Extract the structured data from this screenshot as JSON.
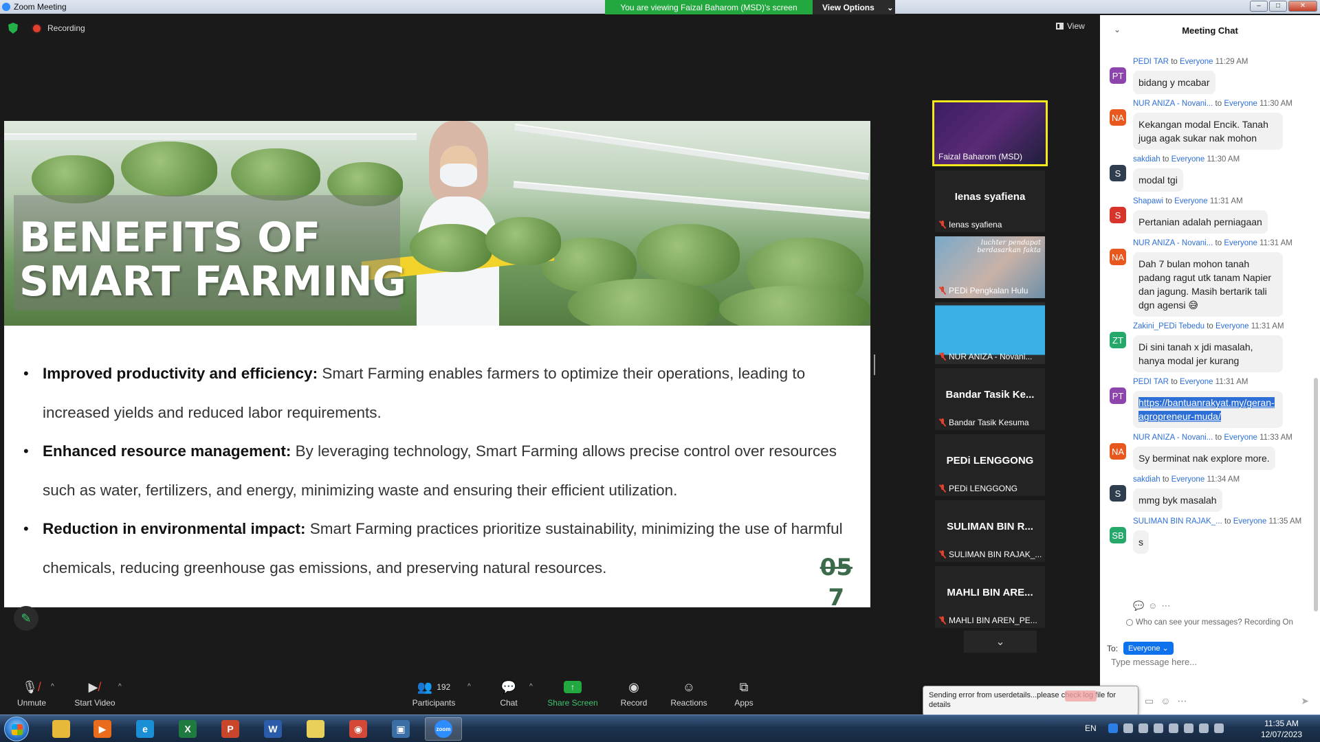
{
  "window": {
    "title": "Zoom Meeting",
    "viewing_banner": "You are viewing Faizal Baharom (MSD)'s screen",
    "view_options": "View Options",
    "recording": "Recording",
    "view_label": "View"
  },
  "slide": {
    "title_line1": "BENEFITS OF",
    "title_line2": "SMART FARMING",
    "bullets": [
      {
        "bold": "Improved productivity and efficiency:",
        "text": " Smart Farming enables farmers to optimize their operations, leading to increased yields and reduced labor requirements."
      },
      {
        "bold": "Enhanced resource management:",
        "text": " By leveraging technology, Smart Farming allows precise control over resources such as water, fertilizers, and energy, minimizing waste and ensuring their efficient utilization."
      },
      {
        "bold": "Reduction in environmental impact:",
        "text": " Smart Farming practices prioritize sustainability, minimizing the use of harmful chemicals, reducing greenhouse gas emissions, and preserving natural resources."
      }
    ],
    "page_num_struck": "05",
    "page_num": "7"
  },
  "video_strip": {
    "active_name": "Faizal Baharom (MSD)",
    "tiles": [
      {
        "big": "Ienas syafiena",
        "name": "Ienas syafiena"
      },
      {
        "name": "PEDi Pengkalan Hulu",
        "handwriting": "luchter pendapat berdasarkan fakta"
      },
      {
        "name": "NUR ANIZA - Novani..."
      },
      {
        "big": "Bandar Tasik Ke...",
        "name": "Bandar Tasik Kesuma"
      },
      {
        "big": "PEDi LENGGONG",
        "name": "PEDi LENGGONG"
      },
      {
        "big": "SULIMAN BIN R...",
        "name": "SULIMAN BIN RAJAK_..."
      },
      {
        "big": "MAHLI BIN ARE...",
        "name": "MAHLI BIN AREN_PE..."
      }
    ]
  },
  "chat": {
    "title": "Meeting Chat",
    "messages": [
      {
        "initials": "PT",
        "color": "#8e44ad",
        "sender": "PEDI TAR",
        "to": "Everyone",
        "time": "11:29 AM",
        "text": "bidang y mcabar"
      },
      {
        "initials": "NA",
        "color": "#e8571e",
        "sender": "NUR ANIZA - Novani...",
        "to": "Everyone",
        "time": "11:30 AM",
        "text": "Kekangan modal Encik. Tanah juga agak sukar nak mohon"
      },
      {
        "initials": "S",
        "color": "#2f3e4e",
        "sender": "sakdiah",
        "to": "Everyone",
        "time": "11:30 AM",
        "text": "modal tgi"
      },
      {
        "initials": "S",
        "color": "#d9342b",
        "sender": "Shapawi",
        "to": "Everyone",
        "time": "11:31 AM",
        "text": "Pertanian adalah perniagaan"
      },
      {
        "initials": "NA",
        "color": "#e8571e",
        "sender": "NUR ANIZA - Novani...",
        "to": "Everyone",
        "time": "11:31 AM",
        "text": "Dah 7 bulan mohon tanah padang ragut utk tanam Napier dan jagung. Masih bertarik tali dgn agensi 😅"
      },
      {
        "initials": "ZT",
        "color": "#27a86b",
        "sender": "Zakini_PEDi Tebedu",
        "to": "Everyone",
        "time": "11:31 AM",
        "text": "Di sini tanah x jdi masalah, hanya modal jer kurang"
      },
      {
        "initials": "PT",
        "color": "#8e44ad",
        "sender": "PEDI TAR",
        "to": "Everyone",
        "time": "11:31 AM",
        "link": "https://bantuanrakyat.my/geran-agropreneur-muda/"
      },
      {
        "initials": "NA",
        "color": "#e8571e",
        "sender": "NUR ANIZA - Novani...",
        "to": "Everyone",
        "time": "11:33 AM",
        "text": "Sy berminat nak explore more."
      },
      {
        "initials": "S",
        "color": "#2f3e4e",
        "sender": "sakdiah",
        "to": "Everyone",
        "time": "11:34 AM",
        "text": "mmg byk masalah"
      },
      {
        "initials": "SB",
        "color": "#27a86b",
        "sender": "SULIMAN BIN RAJAK_...",
        "to": "Everyone",
        "time": "11:35 AM",
        "text": "s"
      }
    ],
    "to_word": "to",
    "who_see": "Who can see your messages? Recording On",
    "to_label": "To:",
    "to_value": "Everyone",
    "input_placeholder": "Type message here..."
  },
  "toolbar": {
    "unmute": "Unmute",
    "start_video": "Start Video",
    "participants": "Participants",
    "participants_count": "192",
    "chat": "Chat",
    "share_screen": "Share Screen",
    "record": "Record",
    "reactions": "Reactions",
    "apps": "Apps"
  },
  "toast": {
    "text": "Sending error from userdetails...please check log file for details"
  },
  "taskbar": {
    "lang": "EN",
    "time": "11:35 AM",
    "date": "12/07/2023",
    "apps": [
      {
        "name": "explorer",
        "color": "#e7b93b",
        "glyph": ""
      },
      {
        "name": "media",
        "color": "#e86c1c",
        "glyph": "▶"
      },
      {
        "name": "edge",
        "color": "#1a8fd6",
        "glyph": "e"
      },
      {
        "name": "excel",
        "color": "#1e7a3e",
        "glyph": "X"
      },
      {
        "name": "powerpoint",
        "color": "#c9462a",
        "glyph": "P"
      },
      {
        "name": "word",
        "color": "#2a5caa",
        "glyph": "W"
      },
      {
        "name": "sticky-notes",
        "color": "#e9d05a",
        "glyph": ""
      },
      {
        "name": "chrome",
        "color": "#d34836",
        "glyph": "◉"
      },
      {
        "name": "remote",
        "color": "#3a6ea5",
        "glyph": "▣"
      },
      {
        "name": "zoom",
        "color": "#2d8cff",
        "glyph": "zoom"
      }
    ]
  }
}
